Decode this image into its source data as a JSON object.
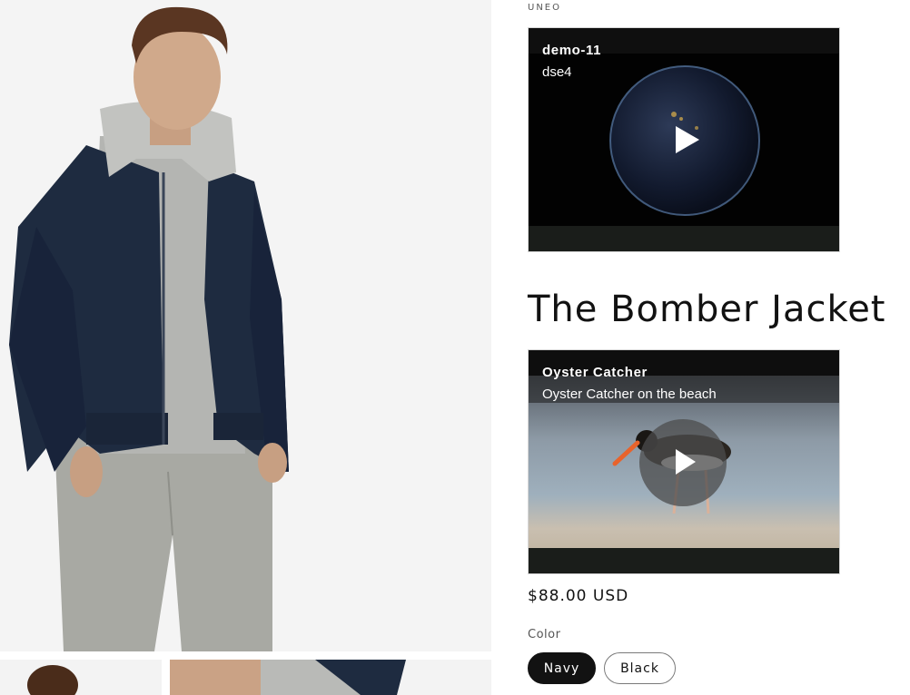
{
  "product": {
    "vendor": "UNEO",
    "title": "The Bomber Jacket",
    "price": "$88.00 USD",
    "color_label": "Color",
    "colors": [
      {
        "label": "Navy",
        "selected": true
      },
      {
        "label": "Black",
        "selected": false
      }
    ]
  },
  "videos": [
    {
      "title": "demo-11",
      "subtitle": "dse4"
    },
    {
      "title": "Oyster Catcher",
      "subtitle": "Oyster Catcher on the beach"
    }
  ],
  "icons": {
    "play": "play-icon"
  }
}
